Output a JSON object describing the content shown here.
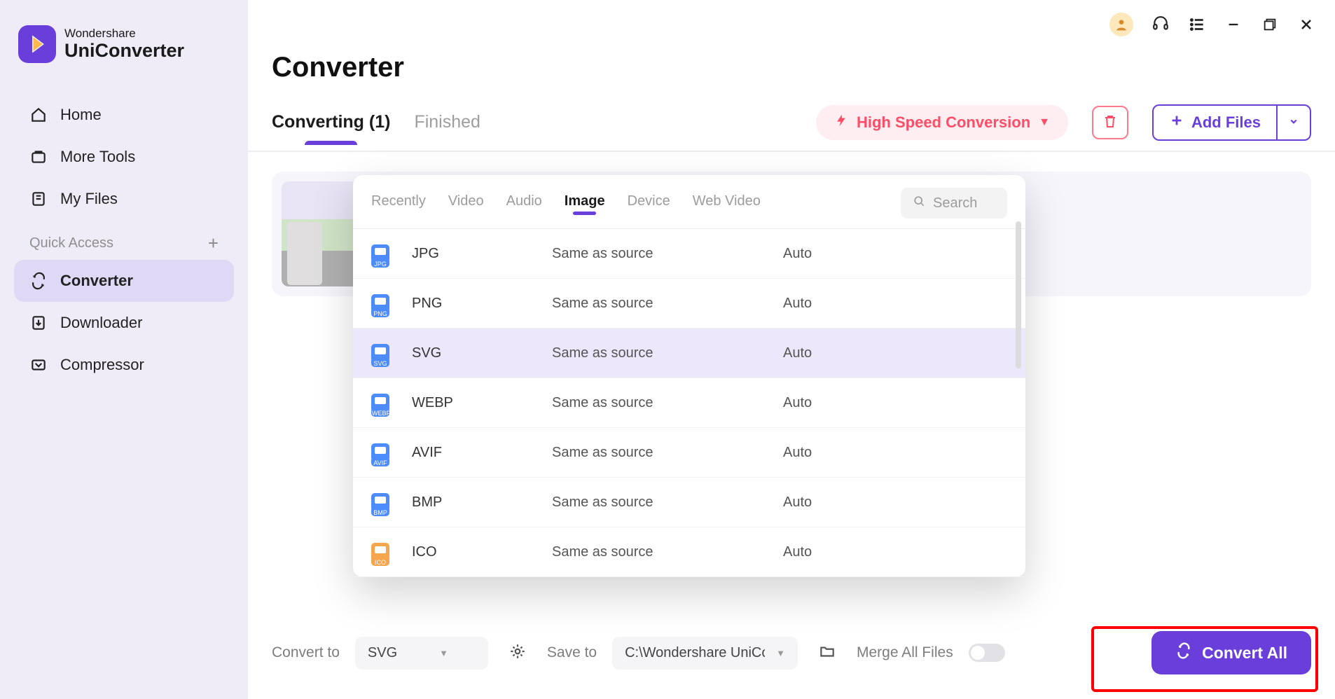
{
  "logo": {
    "brand": "Wondershare",
    "product": "UniConverter"
  },
  "sidebar": {
    "home": "Home",
    "more_tools": "More Tools",
    "my_files": "My Files",
    "quick_access": "Quick Access",
    "converter": "Converter",
    "downloader": "Downloader",
    "compressor": "Compressor"
  },
  "page_title": "Converter",
  "tabs": {
    "converting": "Converting (1)",
    "finished": "Finished"
  },
  "actions": {
    "high_speed": "High Speed Conversion",
    "add_files": "Add Files"
  },
  "popup_tabs": {
    "recently": "Recently",
    "video": "Video",
    "audio": "Audio",
    "image": "Image",
    "device": "Device",
    "web_video": "Web Video"
  },
  "popup_search_placeholder": "Search",
  "formats": [
    {
      "name": "JPG",
      "source": "Same as source",
      "setting": "Auto",
      "badge": "JPG"
    },
    {
      "name": "PNG",
      "source": "Same as source",
      "setting": "Auto",
      "badge": "PNG"
    },
    {
      "name": "SVG",
      "source": "Same as source",
      "setting": "Auto",
      "badge": "SVG",
      "selected": true
    },
    {
      "name": "WEBP",
      "source": "Same as source",
      "setting": "Auto",
      "badge": "WEBP"
    },
    {
      "name": "AVIF",
      "source": "Same as source",
      "setting": "Auto",
      "badge": "AVIF"
    },
    {
      "name": "BMP",
      "source": "Same as source",
      "setting": "Auto",
      "badge": "BMP"
    },
    {
      "name": "ICO",
      "source": "Same as source",
      "setting": "Auto",
      "badge": "ICO",
      "orange": true
    }
  ],
  "footer": {
    "convert_to_label": "Convert to",
    "convert_to_value": "SVG",
    "save_to_label": "Save to",
    "save_to_value": "C:\\Wondershare UniConv",
    "merge_label": "Merge All Files",
    "convert_all": "Convert All"
  }
}
